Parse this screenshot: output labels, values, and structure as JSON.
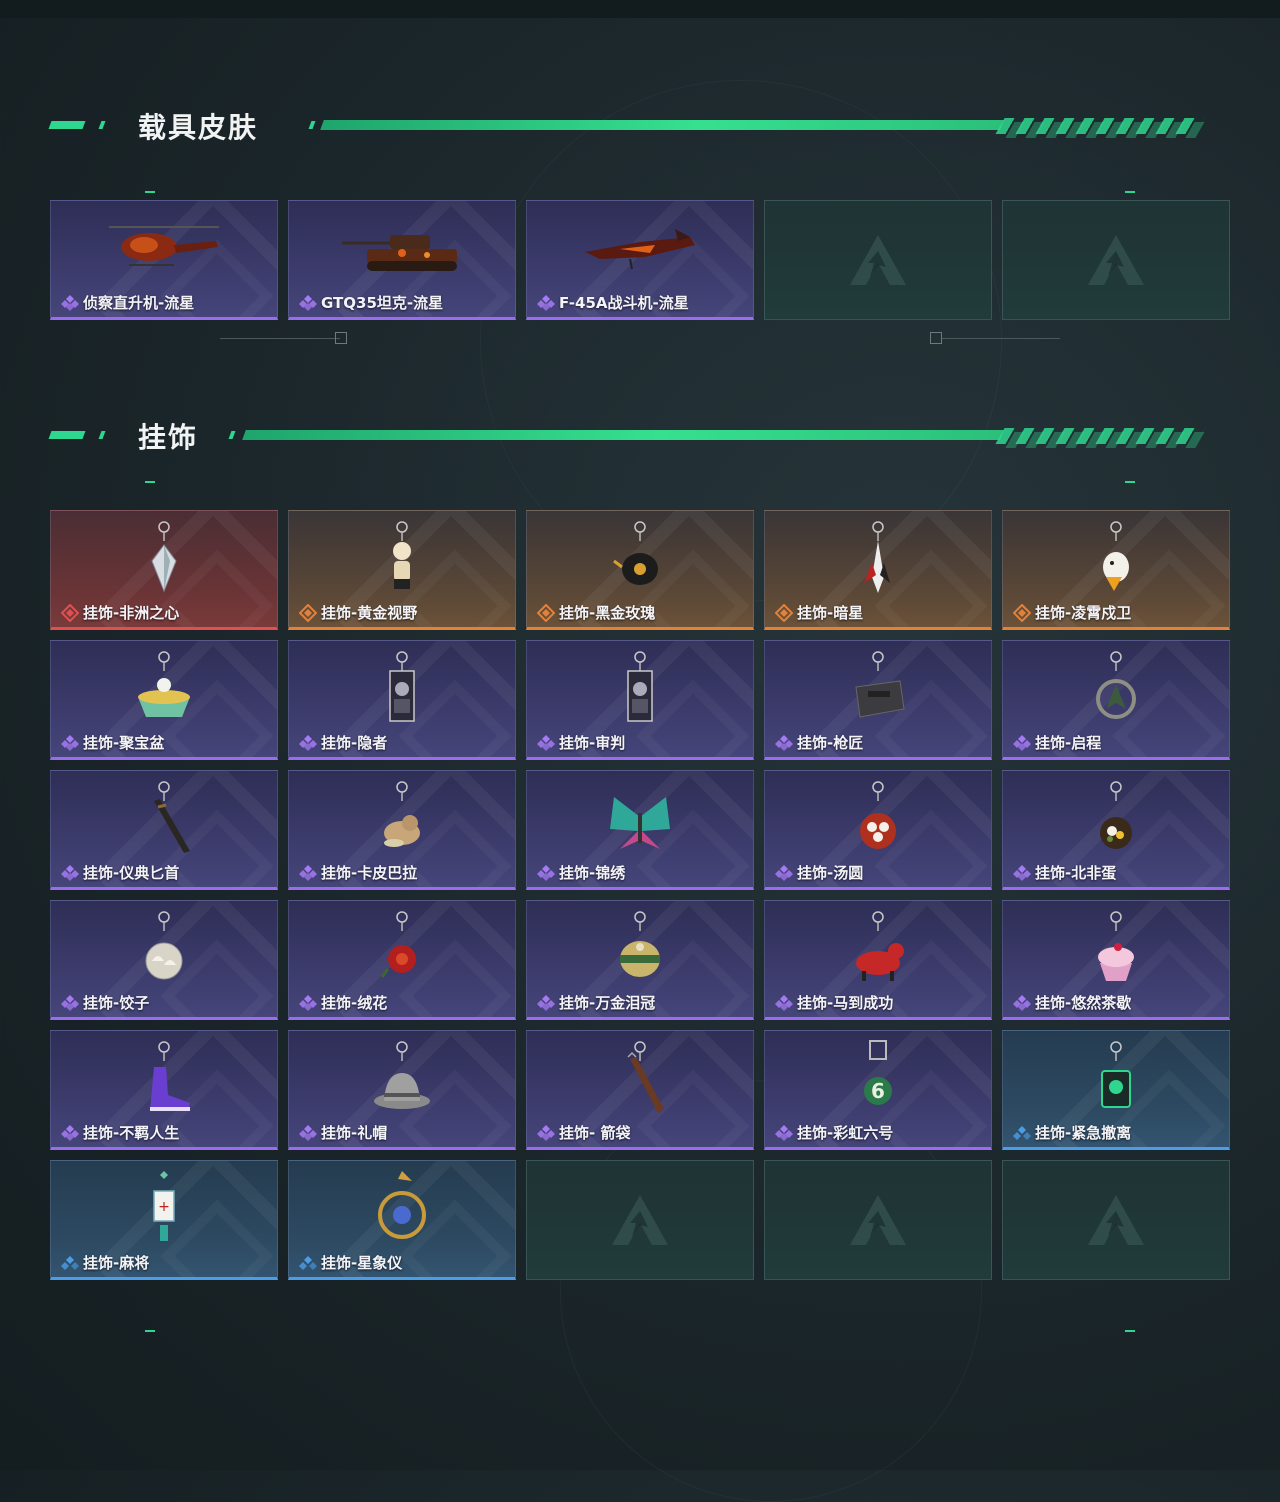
{
  "sections": {
    "vehicle": {
      "title": "载具皮肤",
      "items": [
        {
          "label": "侦察直升机-流星",
          "rarity": "purple",
          "icon": "helicopter-icon"
        },
        {
          "label": "GTQ35坦克-流星",
          "rarity": "purple",
          "icon": "tank-icon"
        },
        {
          "label": "F-45A战斗机-流星",
          "rarity": "purple",
          "icon": "fighter-jet-icon"
        }
      ],
      "empty_slots": 2
    },
    "charms": {
      "title": "挂饰",
      "items": [
        {
          "label": "挂饰-非洲之心",
          "rarity": "red",
          "icon": "diamond-charm-icon"
        },
        {
          "label": "挂饰-黄金视野",
          "rarity": "gold",
          "icon": "figure-charm-icon"
        },
        {
          "label": "挂饰-黑金玫瑰",
          "rarity": "gold",
          "icon": "teapot-charm-icon"
        },
        {
          "label": "挂饰-暗星",
          "rarity": "gold",
          "icon": "bird-charm-icon"
        },
        {
          "label": "挂饰-凌霄戍卫",
          "rarity": "gold",
          "icon": "chick-charm-icon"
        },
        {
          "label": "挂饰-聚宝盆",
          "rarity": "purple",
          "icon": "treasure-bowl-icon"
        },
        {
          "label": "挂饰-隐者",
          "rarity": "purple",
          "icon": "tarot-card-icon"
        },
        {
          "label": "挂饰-审判",
          "rarity": "purple",
          "icon": "tarot-card-icon"
        },
        {
          "label": "挂饰-枪匠",
          "rarity": "purple",
          "icon": "gun-part-icon"
        },
        {
          "label": "挂饰-启程",
          "rarity": "purple",
          "icon": "medallion-icon"
        },
        {
          "label": "挂饰-仪典匕首",
          "rarity": "purple",
          "icon": "dagger-icon"
        },
        {
          "label": "挂饰-卡皮巴拉",
          "rarity": "purple",
          "icon": "capybara-icon"
        },
        {
          "label": "挂饰-锦绣",
          "rarity": "purple",
          "icon": "butterfly-icon"
        },
        {
          "label": "挂饰-汤圆",
          "rarity": "purple",
          "icon": "bowl-icon"
        },
        {
          "label": "挂饰-北非蛋",
          "rarity": "purple",
          "icon": "pan-icon"
        },
        {
          "label": "挂饰-饺子",
          "rarity": "purple",
          "icon": "dumpling-icon"
        },
        {
          "label": "挂饰-绒花",
          "rarity": "purple",
          "icon": "flower-icon"
        },
        {
          "label": "挂饰-万金泪冠",
          "rarity": "purple",
          "icon": "crown-icon"
        },
        {
          "label": "挂饰-马到成功",
          "rarity": "purple",
          "icon": "horse-icon"
        },
        {
          "label": "挂饰-悠然茶歇",
          "rarity": "purple",
          "icon": "cupcake-icon"
        },
        {
          "label": "挂饰-不羁人生",
          "rarity": "purple",
          "icon": "sneaker-icon"
        },
        {
          "label": "挂饰-礼帽",
          "rarity": "purple",
          "icon": "hat-icon"
        },
        {
          "label": "挂饰- 箭袋",
          "rarity": "purple",
          "icon": "quiver-icon"
        },
        {
          "label": "挂饰-彩虹六号",
          "rarity": "purple",
          "icon": "rainbow-six-icon"
        },
        {
          "label": "挂饰-紧急撤离",
          "rarity": "blue",
          "icon": "evac-sign-icon"
        },
        {
          "label": "挂饰-麻将",
          "rarity": "blue",
          "icon": "mahjong-icon"
        },
        {
          "label": "挂饰-星象仪",
          "rarity": "blue",
          "icon": "astrolabe-icon"
        }
      ],
      "empty_slots": 3
    }
  },
  "colors": {
    "accent": "#2fd68f",
    "purple": "#9a6cf0",
    "gold": "#e2823a",
    "red": "#e05050",
    "blue": "#4b9de8"
  }
}
